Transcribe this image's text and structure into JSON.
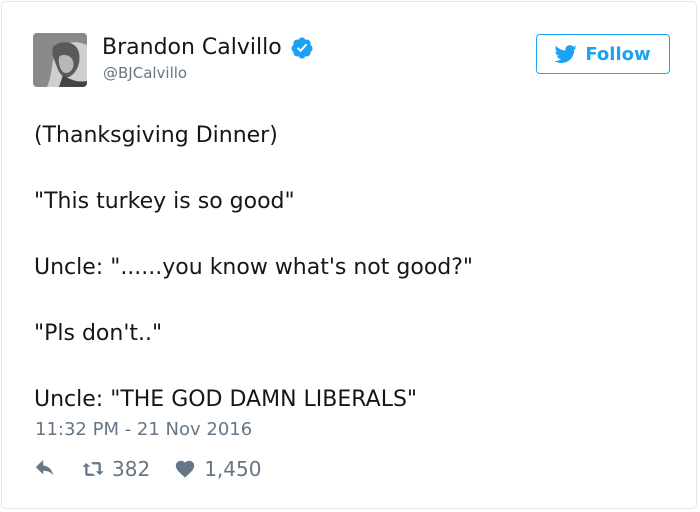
{
  "user": {
    "display_name": "Brandon Calvillo",
    "handle": "@BJCalvillo",
    "verified": true
  },
  "follow_button": {
    "label": "Follow",
    "icon": "twitter-bird-icon"
  },
  "tweet": {
    "lines": [
      "(Thanksgiving Dinner)",
      "\"This turkey is so good\"",
      "Uncle: \"......you know what's not good?\"",
      "\"Pls don't..\"",
      "Uncle: \"THE GOD DAMN LIBERALS\""
    ],
    "timestamp": "11:32 PM - 21 Nov 2016"
  },
  "actions": {
    "reply": {
      "icon": "reply-icon"
    },
    "retweet": {
      "icon": "retweet-icon",
      "count": "382"
    },
    "like": {
      "icon": "heart-icon",
      "count": "1,450"
    }
  },
  "colors": {
    "accent": "#1da1f2",
    "text": "#14171a",
    "muted": "#657786",
    "border": "#e1e8ed"
  }
}
